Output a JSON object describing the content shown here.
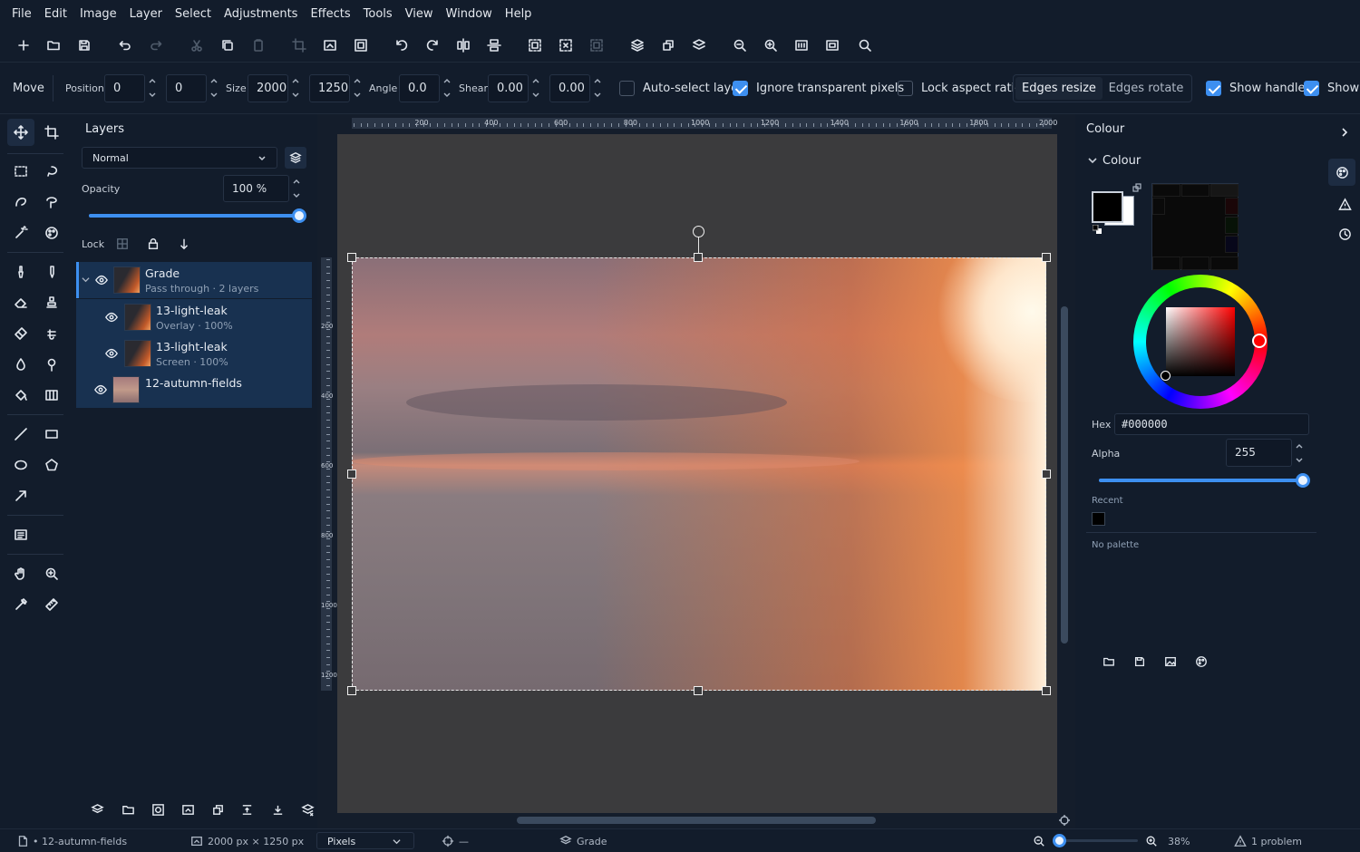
{
  "menu": [
    "File",
    "Edit",
    "Image",
    "Layer",
    "Select",
    "Adjustments",
    "Effects",
    "Tools",
    "View",
    "Window",
    "Help"
  ],
  "toolbar_icons": [
    "new-icon",
    "open-icon",
    "save-icon",
    "undo-icon",
    "redo-icon",
    "cut-icon",
    "copy-icon",
    "paste-icon",
    "crop-icon",
    "resize-image-icon",
    "canvas-size-icon",
    "rotate-left-icon",
    "rotate-right-icon",
    "flip-horizontal-icon",
    "flip-vertical-icon",
    "select-all-icon",
    "deselect-icon",
    "invert-selection-icon",
    "layers-icon",
    "duplicate-layer-icon",
    "merge-layer-icon",
    "zoom-out-icon",
    "zoom-in-icon",
    "actual-size-icon",
    "fit-icon",
    "search-icon"
  ],
  "options": {
    "tool": "Move",
    "position_label": "Position",
    "pos_x": "0",
    "pos_y": "0",
    "size_label": "Size",
    "width": "2000",
    "height": "1250",
    "angle_label": "Angle",
    "angle": "0.0",
    "shear_label": "Shear",
    "shear_x": "0.00",
    "shear_y": "0.00",
    "auto_select": {
      "label": "Auto-select layer",
      "checked": false
    },
    "ignore_transparent": {
      "label": "Ignore transparent pixels",
      "checked": true
    },
    "lock_aspect": {
      "label": "Lock aspect ratio",
      "checked": false
    },
    "mode_tabs": [
      "Edges resize",
      "Edges rotate"
    ],
    "mode_active": "Edges resize",
    "show_handles": {
      "label": "Show handles",
      "checked": true
    },
    "show_extra": {
      "label": "Show",
      "checked": true
    }
  },
  "layers_panel": {
    "title": "Layers",
    "blend_mode": "Normal",
    "opacity_label": "Opacity",
    "opacity": "100 %",
    "opacity_fraction": 1.0,
    "lock_label": "Lock",
    "layers": [
      {
        "name": "Grade",
        "sub": "Pass through · 2 layers"
      },
      {
        "name": "13-light-leak",
        "sub": "Overlay · 100%"
      },
      {
        "name": "13-light-leak",
        "sub": "Screen · 100%"
      },
      {
        "name": "12-autumn-fields",
        "sub": ""
      }
    ]
  },
  "ruler_h": [
    "200",
    "400",
    "600",
    "800",
    "1000",
    "1200",
    "1400",
    "1600",
    "1800",
    "2000"
  ],
  "ruler_v": [
    "200",
    "400",
    "600",
    "800",
    "1000",
    "1200"
  ],
  "colour_panel": {
    "title": "Colour",
    "section": "Colour",
    "hex_label": "Hex",
    "hex": "#000000",
    "alpha_label": "Alpha",
    "alpha": "255",
    "alpha_fraction": 1.0,
    "recent_label": "Recent",
    "no_palette": "No palette",
    "primary_color": "#000000",
    "secondary_color": "#ffffff"
  },
  "status": {
    "document": "• 12-autumn-fields",
    "dimensions": "2000 px × 1250 px",
    "units": "Pixels",
    "cursor": "—",
    "layer": "Grade",
    "zoom": "38%",
    "problems": "1 problem"
  },
  "colors": {
    "accent": "#3d8ff0",
    "bg": "#121c2b",
    "canvas": "#3b3b3d"
  }
}
